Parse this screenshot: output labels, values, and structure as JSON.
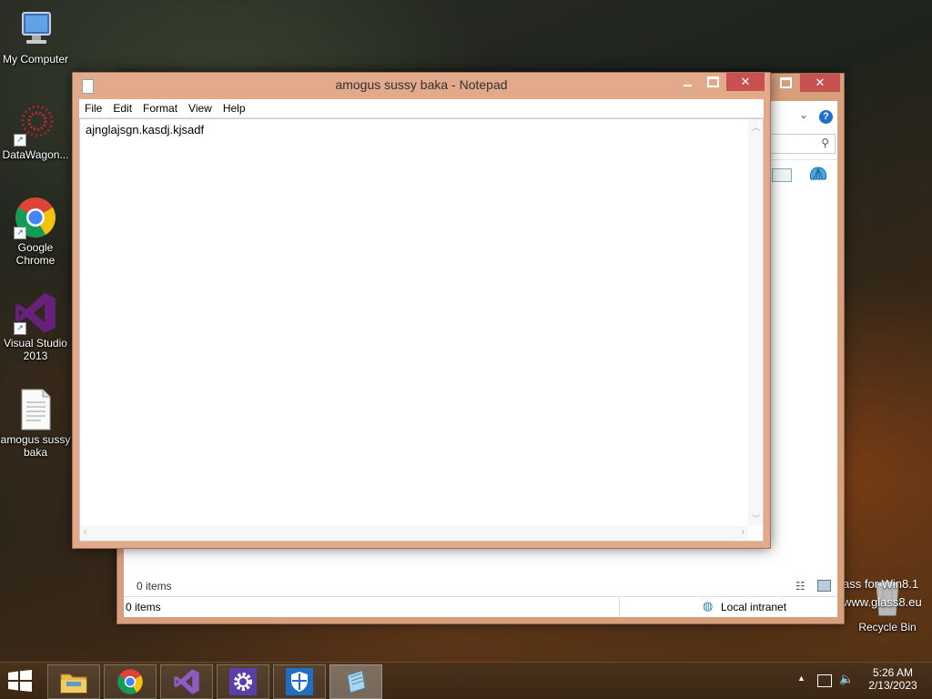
{
  "desktop_icons": [
    {
      "label": "My Computer"
    },
    {
      "label": "DataWagon..."
    },
    {
      "label": "Google Chrome"
    },
    {
      "label": "Visual Studio 2013"
    },
    {
      "label": "amogus sussy baka"
    },
    {
      "label": "Recycle Bin"
    }
  ],
  "watermark": {
    "line1": "ass for Win8.1",
    "line2": "www.glass8.eu"
  },
  "explorer": {
    "items_count": "0 items",
    "status_items": "0 items",
    "zone": "Local intranet"
  },
  "notepad": {
    "title": "amogus sussy baka - Notepad",
    "menu": [
      "File",
      "Edit",
      "Format",
      "View",
      "Help"
    ],
    "content": "ajnglajsgn.kasdj.kjsadf"
  },
  "tray": {
    "time": "5:26 AM",
    "date": "2/13/2023"
  },
  "colors": {
    "frame": "#e2a98a",
    "taskbar": "#3a2714"
  }
}
